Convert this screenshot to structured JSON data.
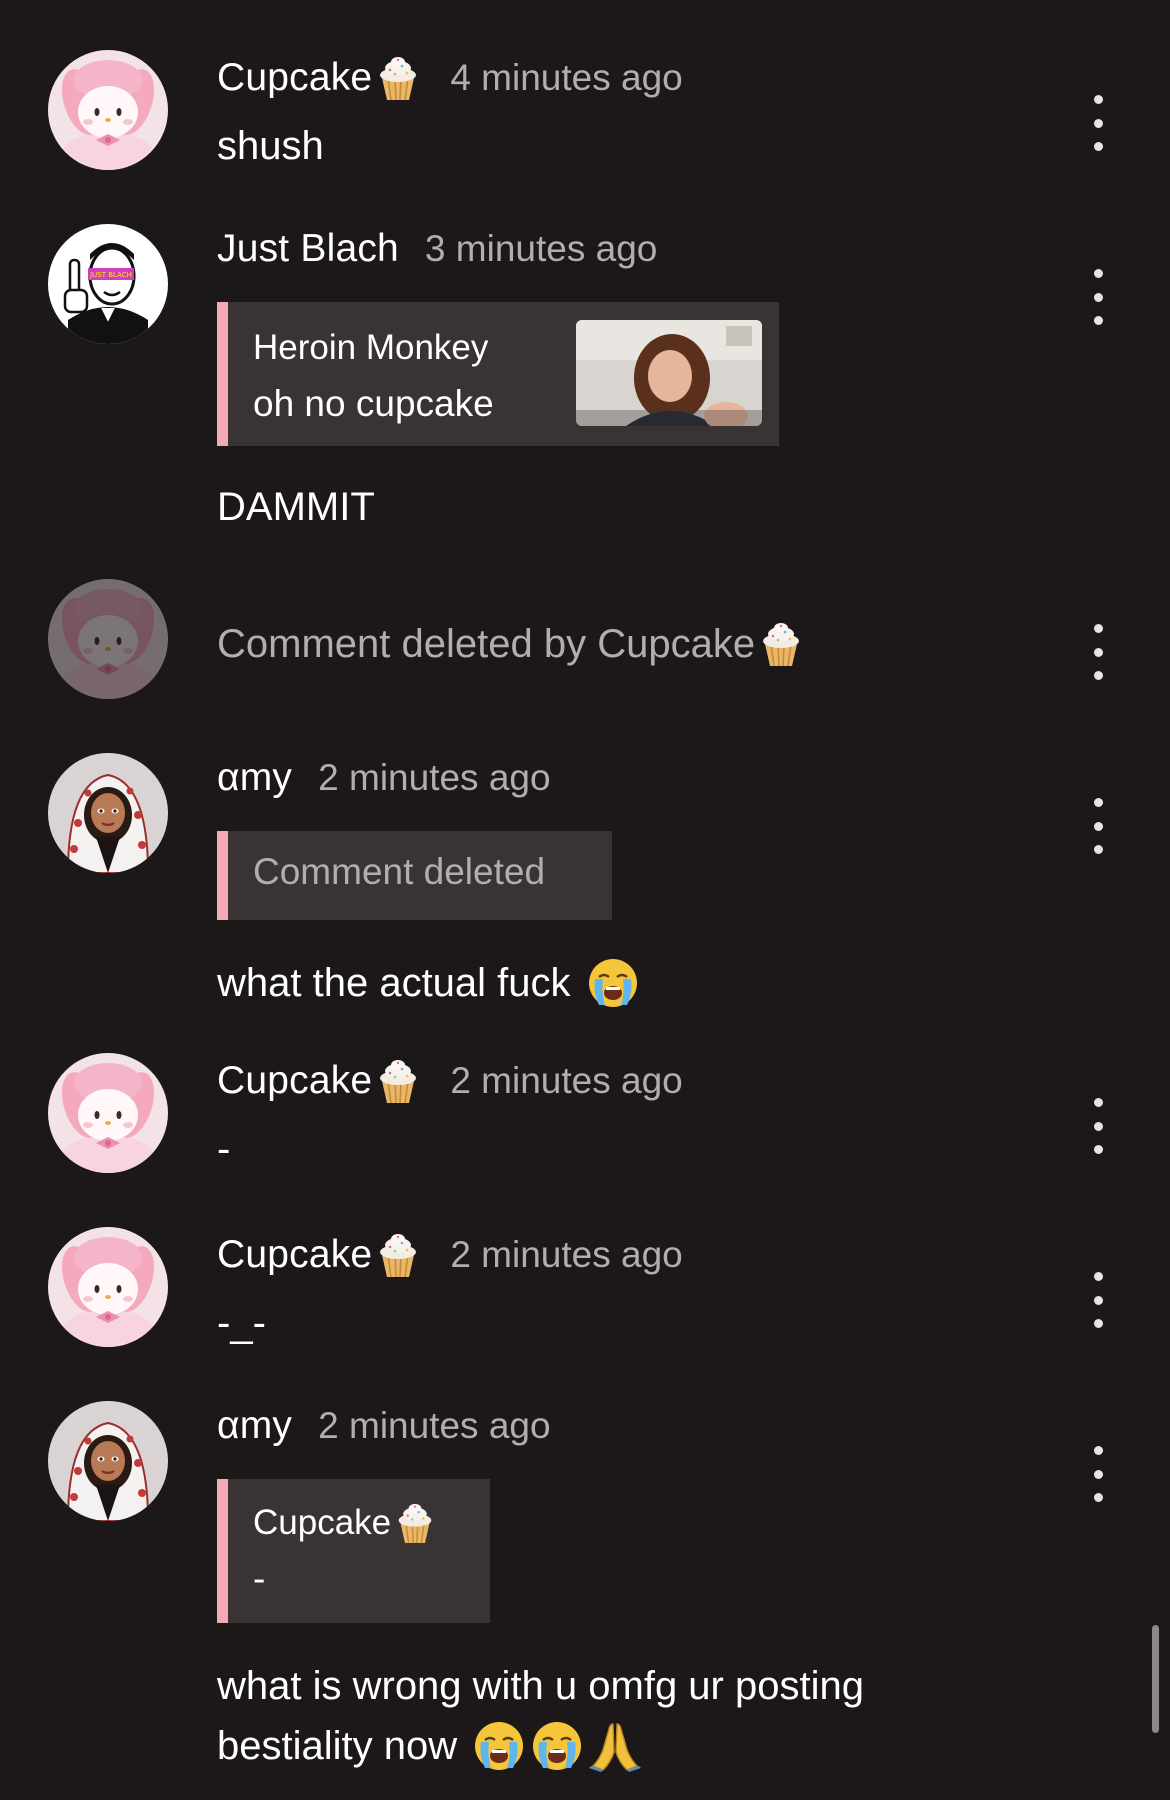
{
  "comments": [
    {
      "username": "Cupcake",
      "timestamp": "4 minutes ago",
      "text": "shush",
      "avatar": "pink-bunny-plush",
      "badge_icon": "cupcake-emoji"
    },
    {
      "username": "Just Blach",
      "timestamp": "3 minutes ago",
      "quote": {
        "author": "Heroin Monkey",
        "text": "oh no cupcake",
        "thumbnail": "selfie-photo"
      },
      "text": "DAMMIT",
      "avatar": "meme-guy-middle-finger"
    },
    {
      "deleted_text": "Comment deleted by Cupcake",
      "avatar": "pink-bunny-plush",
      "badge_icon": "cupcake-emoji"
    },
    {
      "username": "αmy",
      "timestamp": "2 minutes ago",
      "quote": {
        "deleted_text": "Comment deleted"
      },
      "text": "what the actual fuck",
      "emojis": [
        "loudly-crying-face"
      ],
      "avatar": "cartoon-girl-hoodie"
    },
    {
      "username": "Cupcake",
      "timestamp": "2 minutes ago",
      "text": "-",
      "avatar": "pink-bunny-plush",
      "badge_icon": "cupcake-emoji"
    },
    {
      "username": "Cupcake",
      "timestamp": "2 minutes ago",
      "text": "-_-",
      "avatar": "pink-bunny-plush",
      "badge_icon": "cupcake-emoji"
    },
    {
      "username": "αmy",
      "timestamp": "2 minutes ago",
      "quote": {
        "author": "Cupcake",
        "text": "-"
      },
      "text_line1": "what is wrong with u omfg ur posting",
      "text_line2": "bestiality now",
      "emojis": [
        "loudly-crying-face",
        "loudly-crying-face",
        "folded-hands"
      ],
      "avatar": "cartoon-girl-hoodie"
    }
  ],
  "colors": {
    "background": "#1c1718",
    "quote_background": "#3a3334",
    "quote_accent": "#f2aab4",
    "muted_text": "#b3aeae"
  }
}
